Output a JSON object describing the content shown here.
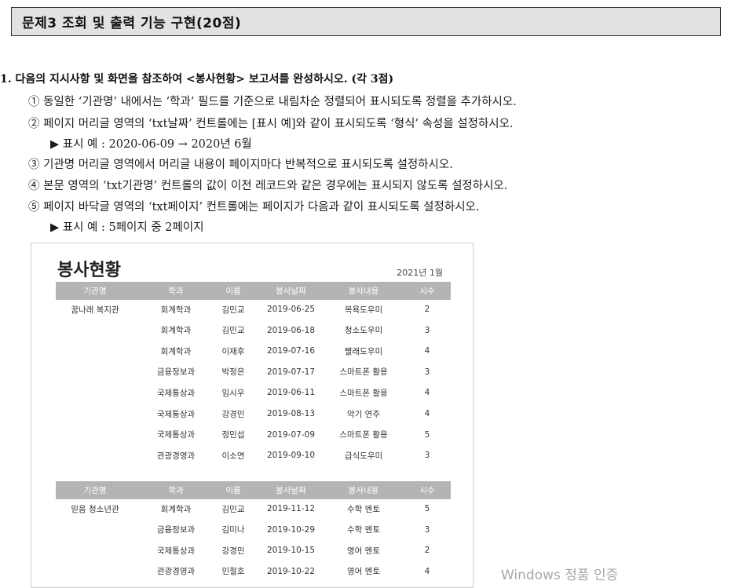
{
  "problem_title": "문제3 조회 및 출력 기능 구현(20점)",
  "question": {
    "heading": "1. 다음의 지시사항 및 화면을 참조하여 <봉사현황> 보고서를 완성하시오. (각 3점)",
    "items": [
      "① 동일한 ‘기관명’ 내에서는 ‘학과’ 필드를 기준으로 내림차순 정렬되어 표시되도록 정렬을 추가하시오.",
      "② 페이지 머리글 영역의 ‘txt날짜’ 컨트롤에는 [표시 예]와 같이 표시되도록 ‘형식’ 속성을 설정하시오.",
      "▶ 표시 예 : 2020-06-09 → 2020년 6월",
      "③ 기관명 머리글 영역에서 머리글 내용이 페이지마다 반복적으로 표시되도록 설정하시오.",
      "④ 본문 영역의 ‘txt기관명’ 컨트롤의 값이 이전 레코드와 같은 경우에는 표시되지 않도록 설정하시오.",
      "⑤ 페이지 바닥글 영역의 ‘txt페이지’ 컨트롤에는 페이지가 다음과 같이 표시되도록 설정하시오.",
      "▶ 표시 예 : 5페이지 중 2페이지"
    ]
  },
  "report": {
    "title": "봉사현황",
    "date": "2021년 1월",
    "columns": [
      "기관명",
      "학과",
      "이름",
      "봉사날짜",
      "봉사내용",
      "시수"
    ],
    "groups": [
      {
        "rows": [
          [
            "꿈나래 복지관",
            "회계학과",
            "김민교",
            "2019-06-25",
            "목욕도우미",
            "2"
          ],
          [
            "",
            "회계학과",
            "김민교",
            "2019-06-18",
            "청소도우미",
            "3"
          ],
          [
            "",
            "회계학과",
            "이재후",
            "2019-07-16",
            "빨래도우미",
            "4"
          ],
          [
            "",
            "금융정보과",
            "박정은",
            "2019-07-17",
            "스마트폰 활용",
            "3"
          ],
          [
            "",
            "국제통상과",
            "임시우",
            "2019-06-11",
            "스마트폰 활용",
            "4"
          ],
          [
            "",
            "국제통상과",
            "강경민",
            "2019-08-13",
            "악기 연주",
            "4"
          ],
          [
            "",
            "국제통상과",
            "정민섭",
            "2019-07-09",
            "스마트폰 활용",
            "5"
          ],
          [
            "",
            "관광경영과",
            "이소연",
            "2019-09-10",
            "급식도우미",
            "3"
          ]
        ]
      },
      {
        "rows": [
          [
            "믿음 청소년관",
            "회계학과",
            "김민교",
            "2019-11-12",
            "수학 멘토",
            "5"
          ],
          [
            "",
            "금융정보과",
            "김미나",
            "2019-10-29",
            "수학 멘토",
            "3"
          ],
          [
            "",
            "국제통상과",
            "강경민",
            "2019-10-15",
            "영어 멘토",
            "2"
          ],
          [
            "",
            "관광경영과",
            "민철호",
            "2019-10-22",
            "영어 멘토",
            "4"
          ]
        ]
      }
    ]
  },
  "watermark": "Windows 정품 인증"
}
